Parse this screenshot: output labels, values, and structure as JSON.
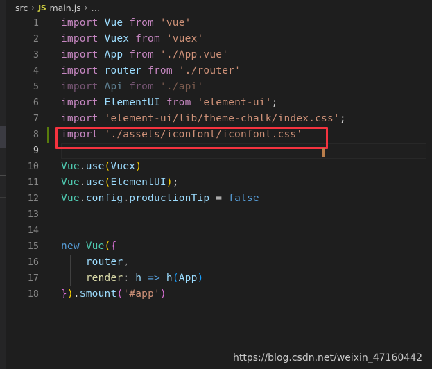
{
  "window": {
    "background": "#1e1e1e",
    "gutter_color": "#858585",
    "accent_annotation": "#f5333f",
    "git_modified": "#587c0c"
  },
  "breadcrumb": {
    "folder": "src",
    "separator_1": "›",
    "file_icon": "JS",
    "file": "main.js",
    "separator_2": "›",
    "symbol": "…"
  },
  "editor": {
    "language": "javascript",
    "active_line": 9,
    "modified_line": 8,
    "lines": [
      {
        "number": "1",
        "tokens": [
          {
            "text": "import ",
            "type": "keyword"
          },
          {
            "text": "Vue",
            "type": "identifier"
          },
          {
            "text": " from ",
            "type": "keyword"
          },
          {
            "text": "'vue'",
            "type": "string"
          }
        ]
      },
      {
        "number": "2",
        "tokens": [
          {
            "text": "import ",
            "type": "keyword"
          },
          {
            "text": "Vuex",
            "type": "identifier"
          },
          {
            "text": " from ",
            "type": "keyword"
          },
          {
            "text": "'vuex'",
            "type": "string"
          }
        ]
      },
      {
        "number": "3",
        "tokens": [
          {
            "text": "import ",
            "type": "keyword"
          },
          {
            "text": "App",
            "type": "identifier"
          },
          {
            "text": " from ",
            "type": "keyword"
          },
          {
            "text": "'./App.vue'",
            "type": "string"
          }
        ]
      },
      {
        "number": "4",
        "tokens": [
          {
            "text": "import ",
            "type": "keyword"
          },
          {
            "text": "router",
            "type": "identifier"
          },
          {
            "text": " from ",
            "type": "keyword"
          },
          {
            "text": "'./router'",
            "type": "string"
          }
        ]
      },
      {
        "number": "5",
        "dimmed": true,
        "tokens": [
          {
            "text": "import ",
            "type": "keyword"
          },
          {
            "text": "Api",
            "type": "identifier"
          },
          {
            "text": " from ",
            "type": "keyword"
          },
          {
            "text": "'./api'",
            "type": "string"
          }
        ]
      },
      {
        "number": "6",
        "tokens": [
          {
            "text": "import ",
            "type": "keyword"
          },
          {
            "text": "ElementUI",
            "type": "identifier"
          },
          {
            "text": " from ",
            "type": "keyword"
          },
          {
            "text": "'element-ui'",
            "type": "string"
          },
          {
            "text": ";",
            "type": "punctuation"
          }
        ]
      },
      {
        "number": "7",
        "tokens": [
          {
            "text": "import ",
            "type": "keyword"
          },
          {
            "text": "'element-ui/lib/theme-chalk/index.css'",
            "type": "string"
          },
          {
            "text": ";",
            "type": "punctuation"
          }
        ]
      },
      {
        "number": "8",
        "annotated": true,
        "modified": true,
        "tokens": [
          {
            "text": "import ",
            "type": "keyword"
          },
          {
            "text": "'./assets/iconfont/iconfont.css'",
            "type": "string"
          }
        ]
      },
      {
        "number": "9",
        "current": true,
        "tokens": []
      },
      {
        "number": "10",
        "tokens": [
          {
            "text": "Vue",
            "type": "class"
          },
          {
            "text": ".",
            "type": "punctuation"
          },
          {
            "text": "use",
            "type": "identifier"
          },
          {
            "text": "(",
            "type": "bracket1"
          },
          {
            "text": "Vuex",
            "type": "identifier"
          },
          {
            "text": ")",
            "type": "bracket1"
          }
        ]
      },
      {
        "number": "11",
        "tokens": [
          {
            "text": "Vue",
            "type": "class"
          },
          {
            "text": ".",
            "type": "punctuation"
          },
          {
            "text": "use",
            "type": "identifier"
          },
          {
            "text": "(",
            "type": "bracket1"
          },
          {
            "text": "ElementUI",
            "type": "identifier"
          },
          {
            "text": ")",
            "type": "bracket1"
          },
          {
            "text": ";",
            "type": "punctuation"
          }
        ]
      },
      {
        "number": "12",
        "tokens": [
          {
            "text": "Vue",
            "type": "class"
          },
          {
            "text": ".",
            "type": "punctuation"
          },
          {
            "text": "config",
            "type": "identifier"
          },
          {
            "text": ".",
            "type": "punctuation"
          },
          {
            "text": "productionTip",
            "type": "identifier"
          },
          {
            "text": " = ",
            "type": "punctuation"
          },
          {
            "text": "false",
            "type": "keyword-blue"
          }
        ]
      },
      {
        "number": "13",
        "tokens": []
      },
      {
        "number": "14",
        "tokens": []
      },
      {
        "number": "15",
        "tokens": [
          {
            "text": "new ",
            "type": "keyword-blue"
          },
          {
            "text": "Vue",
            "type": "class"
          },
          {
            "text": "(",
            "type": "bracket1"
          },
          {
            "text": "{",
            "type": "bracket2"
          }
        ]
      },
      {
        "number": "16",
        "indent_guide": true,
        "tokens": [
          {
            "text": "    ",
            "type": "punctuation"
          },
          {
            "text": "router",
            "type": "identifier"
          },
          {
            "text": ",",
            "type": "punctuation"
          }
        ]
      },
      {
        "number": "17",
        "indent_guide": true,
        "tokens": [
          {
            "text": "    ",
            "type": "punctuation"
          },
          {
            "text": "render",
            "type": "function"
          },
          {
            "text": ": ",
            "type": "punctuation"
          },
          {
            "text": "h ",
            "type": "identifier"
          },
          {
            "text": "=> ",
            "type": "keyword-blue"
          },
          {
            "text": "h",
            "type": "identifier"
          },
          {
            "text": "(",
            "type": "bracket3"
          },
          {
            "text": "App",
            "type": "identifier"
          },
          {
            "text": ")",
            "type": "bracket3"
          }
        ]
      },
      {
        "number": "18",
        "tokens": [
          {
            "text": "}",
            "type": "bracket2"
          },
          {
            "text": ")",
            "type": "bracket1"
          },
          {
            "text": ".",
            "type": "punctuation"
          },
          {
            "text": "$mount",
            "type": "identifier"
          },
          {
            "text": "(",
            "type": "bracket2"
          },
          {
            "text": "'#app'",
            "type": "string"
          },
          {
            "text": ")",
            "type": "bracket2"
          }
        ]
      }
    ]
  },
  "watermark": {
    "text": "https://blog.csdn.net/weixin_47160442"
  }
}
